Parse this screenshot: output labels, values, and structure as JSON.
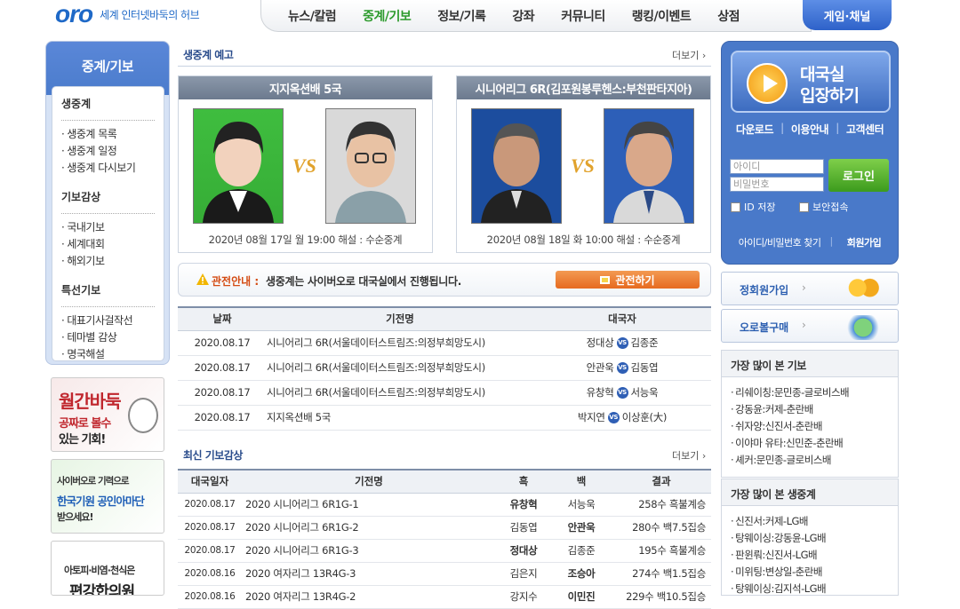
{
  "header": {
    "logo_text": "oro",
    "logo_sub": "세계 인터넷바둑의 허브",
    "menu": [
      "뉴스/칼럼",
      "중계/기보",
      "정보/기록",
      "강좌",
      "커뮤니티",
      "랭킹/이벤트",
      "상점"
    ],
    "active_menu": "중계/기보",
    "game_channel": "게임·채널"
  },
  "lnb": {
    "title": "중계/기보",
    "sections": [
      {
        "heading": "생중계",
        "items": [
          "생중계 목록",
          "생중계 일정",
          "생중계 다시보기"
        ]
      },
      {
        "heading": "기보감상",
        "items": [
          "국내기보",
          "세계대회",
          "해외기보"
        ]
      },
      {
        "heading": "특선기보",
        "items": [
          "대표기사걸작선",
          "테마별 감상",
          "명국해설"
        ]
      }
    ]
  },
  "banners": {
    "b1": {
      "l1": "월간바둑",
      "l2": "공짜로 볼수",
      "l3": "있는 기회!"
    },
    "b2": {
      "l1": "사이버오로 기력으로",
      "l2": "한국기원 공인아마단",
      "l3": "받으세요!"
    },
    "b3": {
      "l1": "아토피·비염·천식은",
      "l2": "편강한의원"
    }
  },
  "preview": {
    "title": "생중계 예고",
    "more": "더보기 ›",
    "matches": [
      {
        "name": "지지옥션배 5국",
        "info": "2020년 08월 17일 월 19:00 해설 : 수순중계"
      },
      {
        "name": "시니어리그 6R(김포원봉루헨스:부천판타지아)",
        "info": "2020년 08월 18일 화 10:00 해설 : 수순중계"
      }
    ],
    "vs": "VS"
  },
  "notice": {
    "label": "관전안내 :",
    "text": "생중계는 사이버오로 대국실에서 진행됩니다.",
    "button": "관전하기"
  },
  "schedule": {
    "headers": [
      "날짜",
      "기전명",
      "대국자"
    ],
    "rows": [
      {
        "date": "2020.08.17",
        "name": "시니어리그 6R(서울데이터스트림즈:의정부희망도시)",
        "p1": "정대상",
        "p2": "김종준"
      },
      {
        "date": "2020.08.17",
        "name": "시니어리그 6R(서울데이터스트림즈:의정부희망도시)",
        "p1": "안관욱",
        "p2": "김동엽"
      },
      {
        "date": "2020.08.17",
        "name": "시니어리그 6R(서울데이터스트림즈:의정부희망도시)",
        "p1": "유창혁",
        "p2": "서능욱"
      },
      {
        "date": "2020.08.17",
        "name": "지지옥션배 5국",
        "p1": "박지연",
        "p2": "이상훈(大)"
      }
    ],
    "vs_mark": "VS"
  },
  "recent": {
    "title": "최신 기보감상",
    "more": "더보기 ›",
    "headers": [
      "대국일자",
      "기전명",
      "흑",
      "백",
      "결과"
    ],
    "rows": [
      {
        "date": "2020.08.17",
        "name": "2020 시니어리그 6R1G-1",
        "black": "유창혁",
        "white": "서능욱",
        "result": "258수 흑불계승",
        "winner": "black"
      },
      {
        "date": "2020.08.17",
        "name": "2020 시니어리그 6R1G-2",
        "black": "김동엽",
        "white": "안관욱",
        "result": "280수 백7.5집승",
        "winner": "white"
      },
      {
        "date": "2020.08.17",
        "name": "2020 시니어리그 6R1G-3",
        "black": "정대상",
        "white": "김종준",
        "result": "195수 흑불계승",
        "winner": "black"
      },
      {
        "date": "2020.08.16",
        "name": "2020 여자리그 13R4G-3",
        "black": "김은지",
        "white": "조승아",
        "result": "274수 백1.5집승",
        "winner": "white"
      },
      {
        "date": "2020.08.16",
        "name": "2020 여자리그 13R4G-2",
        "black": "강지수",
        "white": "이민진",
        "result": "229수 백10.5집승",
        "winner": "white"
      }
    ]
  },
  "login": {
    "enter_l1": "대국실",
    "enter_l2": "입장하기",
    "links": [
      "다운로드",
      "이용안내",
      "고객센터"
    ],
    "id_placeholder": "아이디",
    "pw_placeholder": "비밀번호",
    "login_button": "로그인",
    "save_id": "ID 저장",
    "secure": "보안접속",
    "find": "아이디/비밀번호 찾기",
    "join": "회원가입"
  },
  "right_banners": [
    "정회원가입",
    "오로볼구매"
  ],
  "most_viewed_kibo": {
    "title": "가장 많이 본 기보",
    "items": [
      "리쉐이칭:문민종-글로비스배",
      "강동윤:커제-춘란배",
      "쉬자양:신진서-춘란배",
      "이야마 유타:신민준-춘란배",
      "셰커:문민종-글로비스배"
    ]
  },
  "most_viewed_live": {
    "title": "가장 많이 본 생중계",
    "items": [
      "신진서:커제-LG배",
      "탕웨이싱:강동윤-LG배",
      "판윈뤄:신진서-LG배",
      "미위팅:변상일-춘란배",
      "탕웨이싱:김지석-LG배"
    ]
  },
  "colors": {
    "accent_blue": "#4979c9",
    "active_green": "#2c9a2c",
    "orange": "#e66a1f"
  }
}
